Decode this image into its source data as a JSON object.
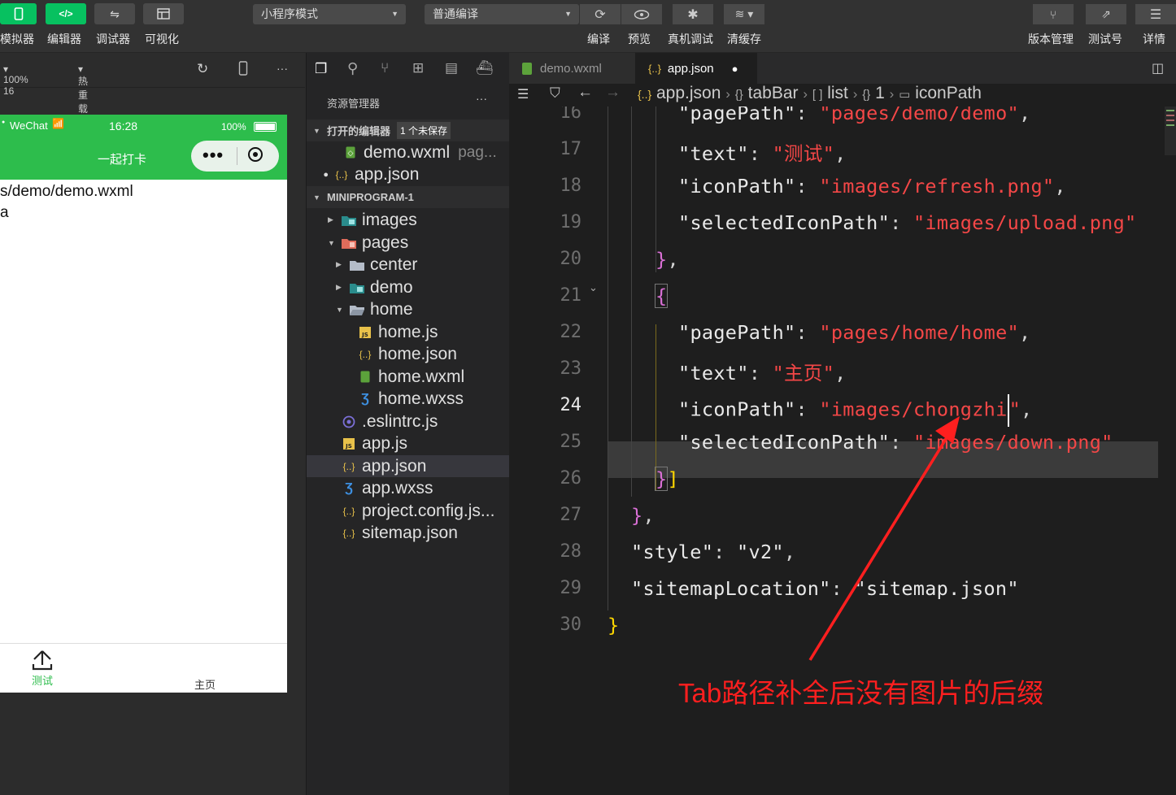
{
  "toolbar": {
    "buttons": [
      {
        "label": "模拟器"
      },
      {
        "label": "编辑器"
      },
      {
        "label": "调试器"
      },
      {
        "label": "可视化"
      }
    ],
    "mode_select": "小程序模式",
    "compile_select": "普通编译",
    "actions": [
      {
        "label": "编译"
      },
      {
        "label": "预览"
      },
      {
        "label": "真机调试"
      },
      {
        "label": "清缓存"
      }
    ],
    "right_actions": [
      {
        "label": "版本管理"
      },
      {
        "label": "测试号"
      },
      {
        "label": "详情"
      }
    ],
    "accent": "#07c160"
  },
  "simulator_bar": {
    "zoom": "100% 16",
    "hot_reload": "热重载 关"
  },
  "phone": {
    "carrier": "WeChat",
    "time": "16:28",
    "battery": "100%",
    "nav_title": "一起打卡",
    "content_lines": [
      "s/demo/demo.wxml",
      "a"
    ],
    "tabs": [
      {
        "label": "测试",
        "active": true
      },
      {
        "label": "主页",
        "active": false
      }
    ],
    "nav_color": "#2dbd4c"
  },
  "explorer": {
    "title": "资源管理器",
    "open_editors": {
      "label": "打开的编辑器",
      "badge": "1 个未保存"
    },
    "open_files": [
      {
        "name": "demo.wxml",
        "hint": "pag..."
      },
      {
        "name": "app.json",
        "hint": ""
      }
    ],
    "project": "MINIPROGRAM-1",
    "tree": [
      {
        "name": "images"
      },
      {
        "name": "pages"
      },
      {
        "name": "center"
      },
      {
        "name": "demo"
      },
      {
        "name": "home"
      },
      {
        "name": "home.js"
      },
      {
        "name": "home.json"
      },
      {
        "name": "home.wxml"
      },
      {
        "name": "home.wxss"
      },
      {
        "name": ".eslintrc.js"
      },
      {
        "name": "app.js"
      },
      {
        "name": "app.json"
      },
      {
        "name": "app.wxss"
      },
      {
        "name": "project.config.js..."
      },
      {
        "name": "sitemap.json"
      }
    ]
  },
  "editor": {
    "tabs": [
      {
        "name": "demo.wxml",
        "active": false
      },
      {
        "name": "app.json",
        "active": true
      }
    ],
    "breadcrumb": {
      "file": "app.json",
      "tabbar": "tabBar",
      "list": "list",
      "index": "1",
      "leaf": "iconPath"
    },
    "line_numbers": [
      "16",
      "17",
      "18",
      "19",
      "20",
      "21",
      "22",
      "23",
      "24",
      "25",
      "26",
      "27",
      "28",
      "29",
      "30"
    ],
    "current_line": "24",
    "code": {
      "l16_key": "\"pagePath\"",
      "l16_val": "\"pages/demo/demo\"",
      "l17_key": "\"text\"",
      "l17_val": "\"测试\"",
      "l18_key": "\"iconPath\"",
      "l18_val": "\"images/refresh.png\"",
      "l19_key": "\"selectedIconPath\"",
      "l19_val": "\"images/upload.png\"",
      "l22_key": "\"pagePath\"",
      "l22_val": "\"pages/home/home\"",
      "l23_key": "\"text\"",
      "l23_val": "\"主页\"",
      "l24_key": "\"iconPath\"",
      "l24_val": "\"images/chongzhi",
      "l25_key": "\"selectedIconPath\"",
      "l25_val": "\"images/down.png\"",
      "l28_key": "\"style\"",
      "l28_val": "\"v2\"",
      "l29_key": "\"sitemapLocation\"",
      "l29_val": "\"sitemap.json\""
    }
  },
  "annotation": "Tab路径补全后没有图片的后缀"
}
